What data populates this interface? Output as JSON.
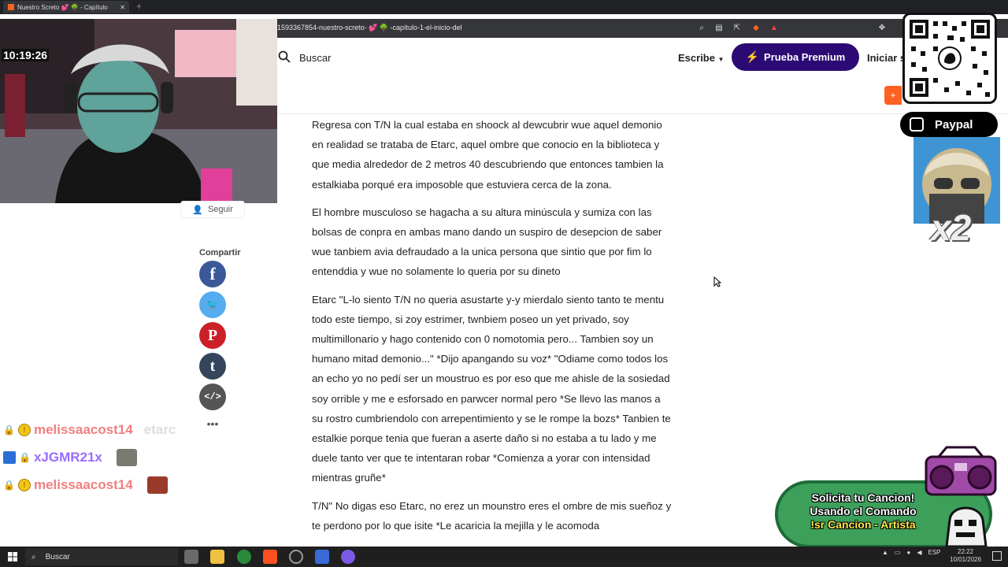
{
  "browser": {
    "tab_title": "Nuestro Screto 💕 🌳 - Capítulo",
    "tab_close": "✕",
    "new_tab": "+",
    "url": "1593367854-nuestro-screto- 💕 🌳 -capítulo-1-el-inicio-del"
  },
  "header": {
    "search_label": "Buscar",
    "write_label": "Escribe",
    "premium_label": "Prueba Premium",
    "login_label": "Iniciar s",
    "orange_tab_label": "+"
  },
  "story": {
    "paragraphs": [
      "Regresa con T/N la cual estaba en shoock al dewcubrir wue aquel demonio en realidad se trataba de Etarc, aquel ombre que conocio en la biblioteca y que media alrededor de 2 metros 40 descubriendo que entonces tambien la estalkiaba porqué era imposoble que estuviera cerca de la zona.",
      "El hombre musculoso se hagacha a su altura minúscula y sumiza con las bolsas de conpra en ambas mano dando un suspiro de desepcion de saber wue tanbiem avia defraudado a la unica persona que sintio que por fim lo entenddia y wue no solamente lo queria por su dineto",
      "Etarc \"L-lo siento T/N no queria asustarte y-y mierdalo siento tanto te mentu todo este tiempo, si zoy estrimer, twnbiem poseo un yet privado, soy multimillonario y hago contenido con 0 nomotomia pero... Tambien soy un humano mitad demonio...\" *Dijo apangando su voz* \"Odiame como todos los an echo yo no pedí ser un moustruo es por eso que me ahisle de la sosiedad soy orrible y me e esforsado en parwcer normal pero *Se llevo las manos a su rostro cumbriendolo con arrepentimiento y se le rompe la bozs* Tanbien te estalkie porque tenia que fueran a aserte daño si no estaba a tu lado y me duele tanto ver que te intentaran robar *Comienza a yorar con intensidad mientras gruñe*",
      "T/N\" No digas eso Etarc, no erez un mounstro eres el ombre de mis sueñoz y te perdono por lo que isite *Le acaricia la mejilla y le acomoda"
    ]
  },
  "sidebar": {
    "follow_label": "Seguir",
    "share_heading": "Compartir",
    "share_buttons": [
      {
        "icon": "facebook-icon",
        "glyph": "f",
        "color": "#3b5998"
      },
      {
        "icon": "twitter-icon",
        "glyph": "🐦",
        "color": "#55acee"
      },
      {
        "icon": "pinterest-icon",
        "glyph": "P",
        "color": "#cb2027"
      },
      {
        "icon": "tumblr-icon",
        "glyph": "t",
        "color": "#35465c"
      },
      {
        "icon": "embed-icon",
        "glyph": "</>",
        "color": "#555555"
      }
    ],
    "more_label": "•••"
  },
  "webcam": {
    "clock_text": "10:19:26"
  },
  "chat": [
    {
      "user": "melissaacost14",
      "message": "etarc",
      "style": "pink"
    },
    {
      "user": "xJGMR21x",
      "message": "",
      "style": "purple"
    },
    {
      "user": "melissaacost14",
      "message": "",
      "style": "pink"
    }
  ],
  "overlays": {
    "paypal_label": "Paypal",
    "multiplier": "x2",
    "song_request": [
      "Solicita tu Cancion!",
      "Usando el Comando",
      "!sr Cancion - Artista"
    ]
  },
  "taskbar": {
    "search_label": "Buscar",
    "language": "ESP",
    "time": "22:22",
    "date": "10/01/2026"
  }
}
